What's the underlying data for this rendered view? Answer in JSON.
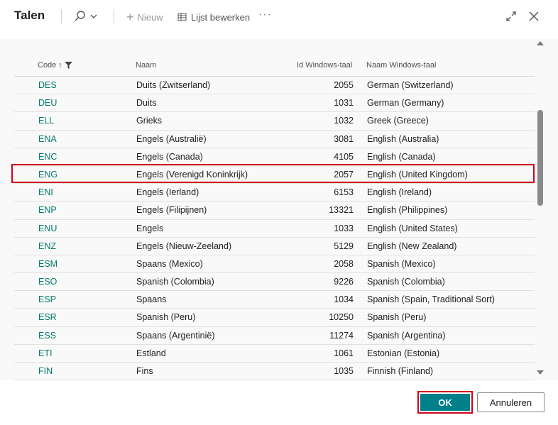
{
  "dialog": {
    "title": "Talen",
    "toolbar": {
      "new_label": "Nieuw",
      "edit_list_label": "Lijst bewerken",
      "more_label": "···"
    },
    "icons": {
      "search": "search-icon",
      "new": "plus-icon",
      "edit_list": "edit-list-icon",
      "expand": "expand-icon",
      "close": "close-icon",
      "sort": "sort-arrow-up-icon",
      "filter": "filter-icon"
    }
  },
  "table": {
    "columns": {
      "code": "Code",
      "naam": "Naam",
      "id_windows": "Id Windows-taal",
      "naam_windows": "Naam Windows-taal"
    },
    "sort_indicator": "↑",
    "rows": [
      {
        "code": "DES",
        "naam": "Duits (Zwitserland)",
        "id": "2055",
        "windows": "German (Switzerland)"
      },
      {
        "code": "DEU",
        "naam": "Duits",
        "id": "1031",
        "windows": "German (Germany)"
      },
      {
        "code": "ELL",
        "naam": "Grieks",
        "id": "1032",
        "windows": "Greek (Greece)"
      },
      {
        "code": "ENA",
        "naam": "Engels (Australië)",
        "id": "3081",
        "windows": "English (Australia)"
      },
      {
        "code": "ENC",
        "naam": "Engels (Canada)",
        "id": "4105",
        "windows": "English (Canada)"
      },
      {
        "code": "ENG",
        "naam": "Engels (Verenigd Koninkrijk)",
        "id": "2057",
        "windows": "English (United Kingdom)"
      },
      {
        "code": "ENI",
        "naam": "Engels (Ierland)",
        "id": "6153",
        "windows": "English (Ireland)"
      },
      {
        "code": "ENP",
        "naam": "Engels (Filipijnen)",
        "id": "13321",
        "windows": "English (Philippines)"
      },
      {
        "code": "ENU",
        "naam": "Engels",
        "id": "1033",
        "windows": "English (United States)"
      },
      {
        "code": "ENZ",
        "naam": "Engels (Nieuw-Zeeland)",
        "id": "5129",
        "windows": "English (New Zealand)"
      },
      {
        "code": "ESM",
        "naam": "Spaans (Mexico)",
        "id": "2058",
        "windows": "Spanish (Mexico)"
      },
      {
        "code": "ESO",
        "naam": "Spanish (Colombia)",
        "id": "9226",
        "windows": "Spanish (Colombia)"
      },
      {
        "code": "ESP",
        "naam": "Spaans",
        "id": "1034",
        "windows": "Spanish (Spain, Traditional Sort)"
      },
      {
        "code": "ESR",
        "naam": "Spanish (Peru)",
        "id": "10250",
        "windows": "Spanish (Peru)"
      },
      {
        "code": "ESS",
        "naam": "Spaans (Argentinië)",
        "id": "11274",
        "windows": "Spanish (Argentina)"
      },
      {
        "code": "ETI",
        "naam": "Estland",
        "id": "1061",
        "windows": "Estonian (Estonia)"
      },
      {
        "code": "FIN",
        "naam": "Fins",
        "id": "1035",
        "windows": "Finnish (Finland)"
      }
    ],
    "highlighted_code": "ENG"
  },
  "footer": {
    "ok_label": "OK",
    "cancel_label": "Annuleren"
  },
  "colors": {
    "accent": "#00808a",
    "code_link": "#00796b",
    "highlight": "#d0021b"
  }
}
